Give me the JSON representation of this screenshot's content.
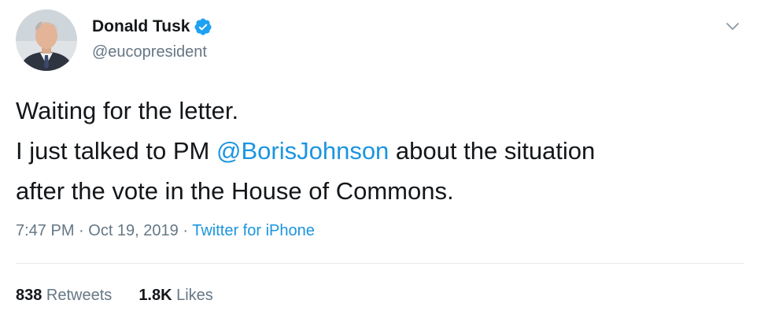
{
  "author": {
    "display_name": "Donald Tusk",
    "handle": "@eucopresident",
    "verified": true,
    "avatar": "profile-photo"
  },
  "tweet": {
    "line1": "Waiting for the letter.",
    "line2_before": "I just talked to PM ",
    "mention": "@BorisJohnson",
    "line2_after": " about the situation",
    "line3": "after the vote in the House of Commons."
  },
  "meta": {
    "time": "7:47 PM",
    "separator1": " · ",
    "date": "Oct 19, 2019",
    "separator2": " · ",
    "source": "Twitter for iPhone"
  },
  "stats": {
    "retweets_count": "838",
    "retweets_label": " Retweets",
    "likes_count": "1.8K",
    "likes_label": " Likes"
  },
  "icons": {
    "verified": "verified-badge-icon",
    "menu": "chevron-down-icon"
  },
  "colors": {
    "link": "#1b95e0",
    "secondary_text": "#657786",
    "primary_text": "#14171a",
    "verified": "#1da1f2"
  }
}
